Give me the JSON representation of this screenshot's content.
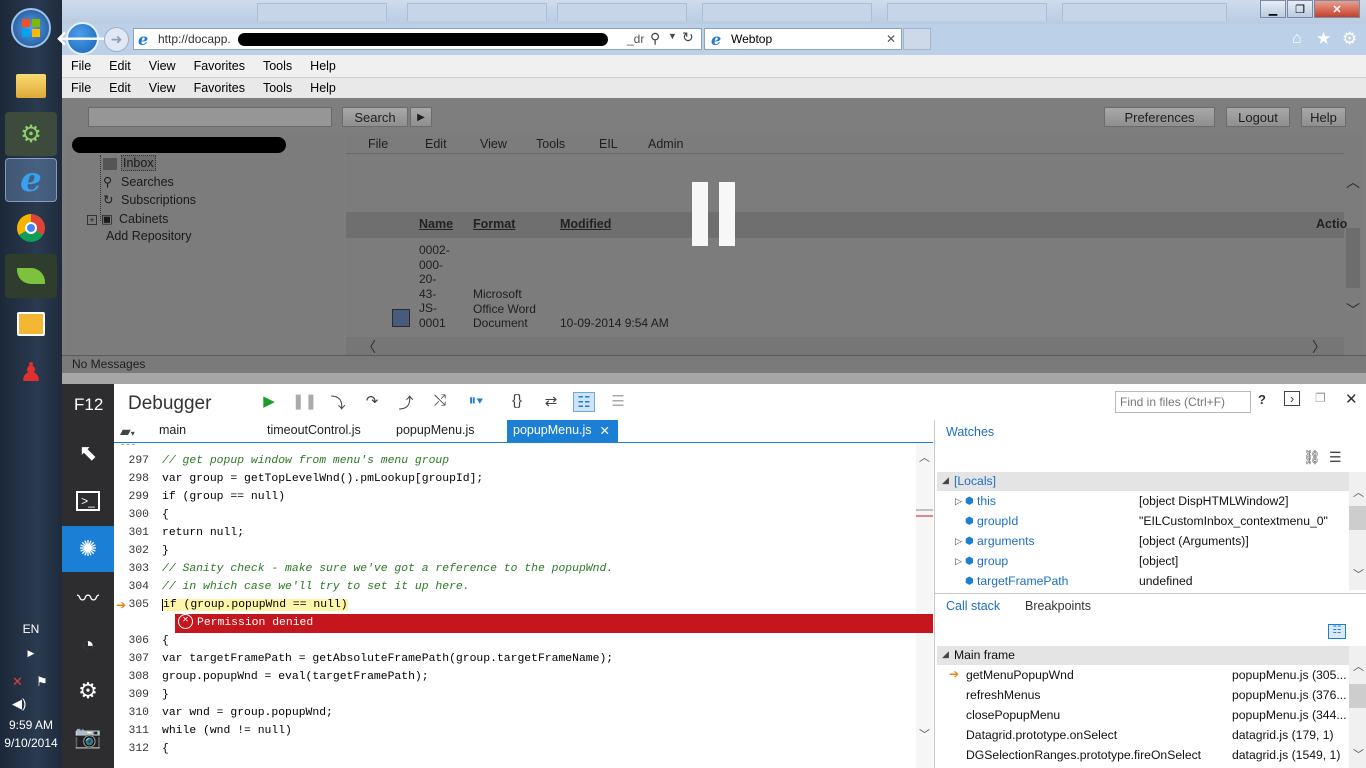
{
  "taskbar": {
    "language": "EN",
    "time": "9:59 AM",
    "date": "9/10/2014",
    "apps": [
      "windows-start",
      "file-explorer",
      "network-tool",
      "internet-explorer",
      "chrome",
      "leaf-app",
      "outlook",
      "user-tool"
    ]
  },
  "browser": {
    "address": "http://docapp.",
    "address_tail": "_dr",
    "tab_title": "Webtop",
    "menu": [
      "File",
      "Edit",
      "View",
      "Favorites",
      "Tools",
      "Help"
    ]
  },
  "webtop": {
    "menu": [
      "File",
      "Edit",
      "View",
      "Favorites",
      "Tools",
      "Help"
    ],
    "search_button": "Search",
    "search_arrow": "▶",
    "top_buttons": [
      "Preferences",
      "Logout",
      "Help"
    ],
    "tree": {
      "inbox": "Inbox",
      "searches": "Searches",
      "subscriptions": "Subscriptions",
      "cabinets": "Cabinets",
      "add_repository": "Add Repository"
    },
    "content_menu": [
      "File",
      "Edit",
      "View",
      "Tools",
      "EIL",
      "Admin"
    ],
    "columns": {
      "name": "Name",
      "format": "Format",
      "modified": "Modified",
      "actions": "Actio"
    },
    "document": {
      "name_lines": [
        "0002-",
        "000-",
        "20-",
        "43-",
        "JS-",
        "0001"
      ],
      "format_lines": [
        "Microsoft",
        "Office Word",
        "Document"
      ],
      "modified": "10-09-2014 9:54 AM"
    },
    "status": "No Messages"
  },
  "devtools": {
    "f12_label": "F12",
    "tool_title": "Debugger",
    "find_placeholder": "Find in files (Ctrl+F)",
    "help": "?",
    "file_tabs": [
      "main",
      "timeoutControl.js",
      "popupMenu.js",
      "popupMenu.js"
    ],
    "active_tab_close": "✕",
    "code_lines": [
      {
        "n": "297",
        "text": "// get popup window from menu's menu group",
        "comment": true
      },
      {
        "n": "298",
        "text": "var group = getTopLevelWnd().pmLookup[groupId];"
      },
      {
        "n": "299",
        "text": "if (group == null)"
      },
      {
        "n": "300",
        "text": "{"
      },
      {
        "n": "301",
        "text": "return null;"
      },
      {
        "n": "302",
        "text": "}"
      },
      {
        "n": "303",
        "text": "// Sanity check - make sure we've got a reference to the popupWnd.",
        "comment": true
      },
      {
        "n": "304",
        "text": "// in which case we'll try to set it up here.",
        "comment": true
      },
      {
        "n": "305",
        "text": "if (group.popupWnd == null)"
      },
      {
        "n": "306",
        "text": "{"
      },
      {
        "n": "307",
        "text": "var targetFramePath = getAbsoluteFramePath(group.targetFrameName);"
      },
      {
        "n": "308",
        "text": "group.popupWnd = eval(targetFramePath);"
      },
      {
        "n": "309",
        "text": "}"
      },
      {
        "n": "310",
        "text": "var wnd = group.popupWnd;"
      },
      {
        "n": "311",
        "text": "while (wnd != null)"
      },
      {
        "n": "312",
        "text": "{"
      }
    ],
    "error_message": "Permission denied",
    "watches": {
      "title": "Watches",
      "locals_label": "[Locals]",
      "rows": [
        {
          "name": "this",
          "value": "[object DispHTMLWindow2]",
          "expandable": true
        },
        {
          "name": "groupId",
          "value": "\"EILCustomInbox_contextmenu_0\"",
          "expandable": false
        },
        {
          "name": "arguments",
          "value": "[object (Arguments)]",
          "expandable": true
        },
        {
          "name": "group",
          "value": "[object]",
          "expandable": true
        },
        {
          "name": "targetFramePath",
          "value": "undefined",
          "expandable": false
        }
      ]
    },
    "callstack": {
      "tab_callstack": "Call stack",
      "tab_breakpoints": "Breakpoints",
      "frame_label": "Main frame",
      "rows": [
        {
          "name": "getMenuPopupWnd",
          "loc": "popupMenu.js (305..."
        },
        {
          "name": "refreshMenus",
          "loc": "popupMenu.js (376..."
        },
        {
          "name": "closePopupMenu",
          "loc": "popupMenu.js (344..."
        },
        {
          "name": "Datagrid.prototype.onSelect",
          "loc": "datagrid.js (179, 1)"
        },
        {
          "name": "DGSelectionRanges.prototype.fireOnSelect",
          "loc": "datagrid.js (1549, 1)"
        }
      ]
    }
  }
}
